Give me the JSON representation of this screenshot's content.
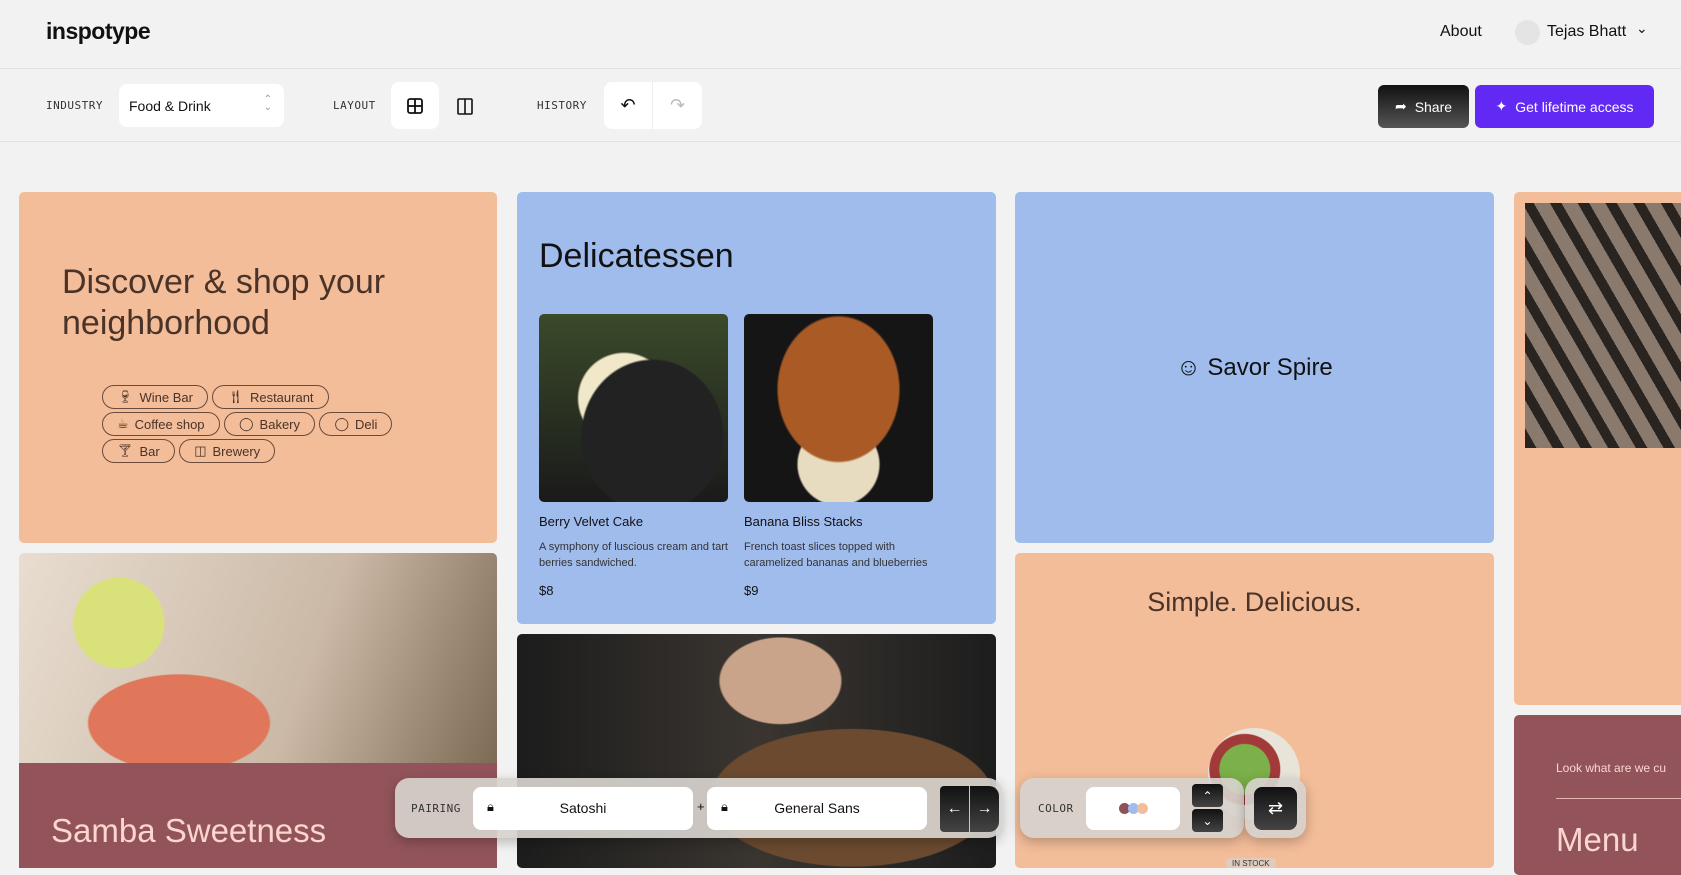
{
  "header": {
    "logo": "inspotype",
    "about": "About",
    "user_name": "Tejas Bhatt"
  },
  "toolbar": {
    "industry_label": "INDUSTRY",
    "industry_value": "Food & Drink",
    "layout_label": "LAYOUT",
    "history_label": "HISTORY",
    "share": "Share",
    "get_access": "Get lifetime access"
  },
  "cards": {
    "discover": {
      "title": "Discover & shop your neighborhood",
      "chips": [
        "Wine Bar",
        "Restaurant",
        "Coffee shop",
        "Bakery",
        "Deli",
        "Bar",
        "Brewery"
      ]
    },
    "deli": {
      "title": "Delicatessen",
      "dishes": [
        {
          "name": "Berry Velvet Cake",
          "desc": "A symphony of luscious cream and tart berries sandwiched.",
          "price": "$8"
        },
        {
          "name": "Banana Bliss Stacks",
          "desc": "French toast slices topped with caramelized bananas and blueberries",
          "price": "$9"
        }
      ]
    },
    "brand": {
      "name": "Savor Spire"
    },
    "simple": {
      "title": "Simple. Delicious.",
      "badge": "IN STOCK"
    },
    "samba": {
      "title": "Samba Sweetness"
    },
    "menu": {
      "intro": "Look what are we cu",
      "title": "Menu"
    }
  },
  "pairing": {
    "label": "PAIRING",
    "font1": "Satoshi",
    "plus": "+",
    "font2": "General Sans"
  },
  "color": {
    "label": "COLOR",
    "swatches": [
      "#8f5058",
      "#a0bced",
      "#f3bd99"
    ]
  }
}
